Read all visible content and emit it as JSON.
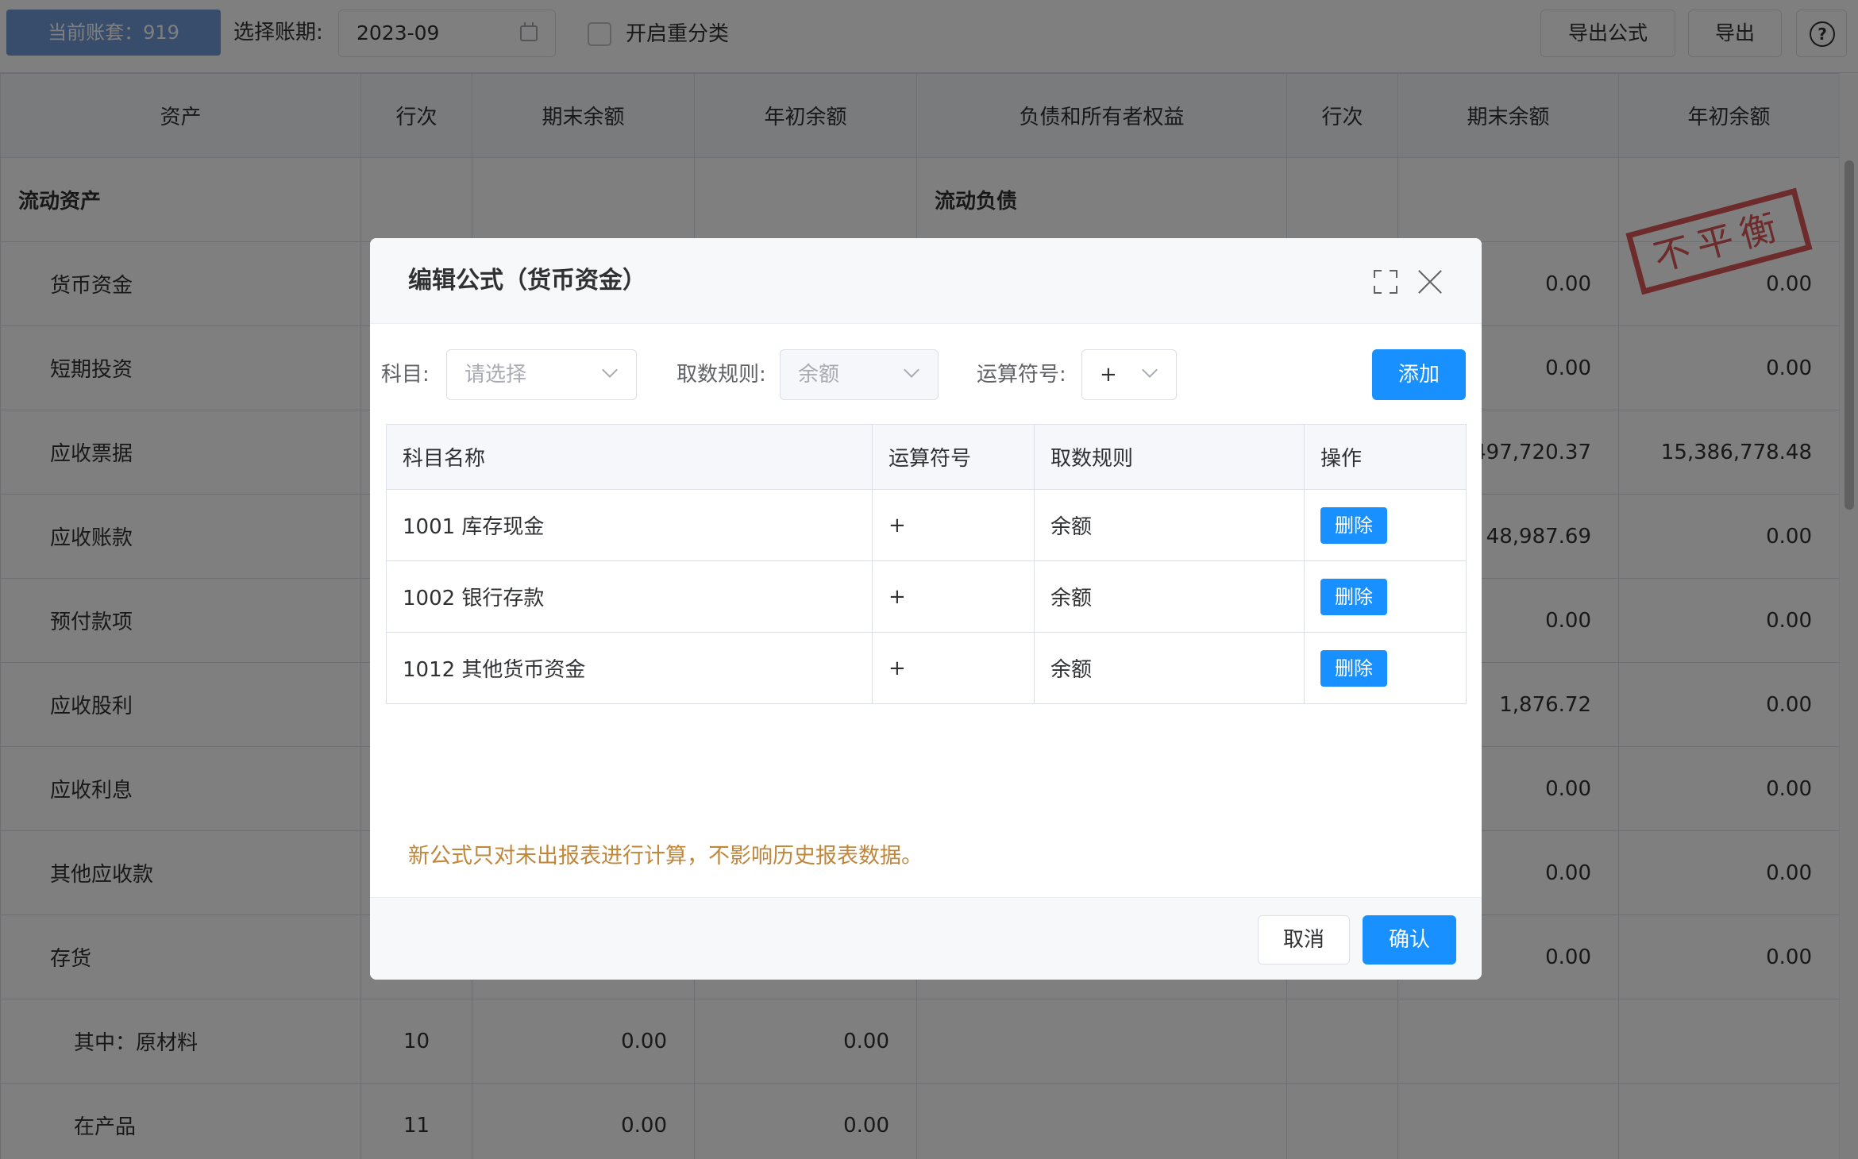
{
  "toolbar": {
    "account_label": "当前账套：919",
    "period_label": "选择账期:",
    "period_value": "2023-09",
    "reclassify_label": "开启重分类",
    "export_formula_label": "导出公式",
    "export_label": "导出",
    "help_icon": "question-circle-icon"
  },
  "report": {
    "columns": [
      "资产",
      "行次",
      "期末余额",
      "年初余额",
      "负债和所有者权益",
      "行次",
      "期末余额",
      "年初余额"
    ],
    "rows": [
      {
        "asset": "流动资产",
        "line": "",
        "end": "",
        "begin": "",
        "liab": "流动负债",
        "lline": "",
        "lend": "",
        "lbegin": ""
      },
      {
        "asset": "货币资金",
        "line": "",
        "end": "",
        "begin": "",
        "liab": "",
        "lline": "",
        "lend": "0.00",
        "lbegin": "0.00"
      },
      {
        "asset": "短期投资",
        "line": "",
        "end": "",
        "begin": "",
        "liab": "",
        "lline": "",
        "lend": "0.00",
        "lbegin": "0.00"
      },
      {
        "asset": "应收票据",
        "line": "",
        "end": "",
        "begin": "",
        "liab": "",
        "lline": "",
        "lend": "497,720.37",
        "lbegin": "15,386,778.48"
      },
      {
        "asset": "应收账款",
        "line": "",
        "end": "",
        "begin": "",
        "liab": "",
        "lline": "",
        "lend": "48,987.69",
        "lbegin": "0.00"
      },
      {
        "asset": "预付款项",
        "line": "",
        "end": "",
        "begin": "",
        "liab": "",
        "lline": "",
        "lend": "0.00",
        "lbegin": "0.00"
      },
      {
        "asset": "应收股利",
        "line": "",
        "end": "",
        "begin": "",
        "liab": "",
        "lline": "",
        "lend": "1,876.72",
        "lbegin": "0.00"
      },
      {
        "asset": "应收利息",
        "line": "",
        "end": "",
        "begin": "",
        "liab": "",
        "lline": "",
        "lend": "0.00",
        "lbegin": "0.00"
      },
      {
        "asset": "其他应收款",
        "line": "",
        "end": "",
        "begin": "",
        "liab": "",
        "lline": "",
        "lend": "0.00",
        "lbegin": "0.00"
      },
      {
        "asset": "存货",
        "line": "",
        "end": "",
        "begin": "",
        "liab": "",
        "lline": "",
        "lend": "0.00",
        "lbegin": "0.00"
      },
      {
        "asset": "其中：原材料",
        "line": "10",
        "end": "0.00",
        "begin": "0.00",
        "liab": "",
        "lline": "",
        "lend": "",
        "lbegin": ""
      },
      {
        "asset": "在产品",
        "line": "11",
        "end": "0.00",
        "begin": "0.00",
        "liab": "",
        "lline": "",
        "lend": "",
        "lbegin": ""
      }
    ],
    "stamp_text": "不平衡",
    "stamp_color": "#d63a3a"
  },
  "dialog": {
    "title": "编辑公式（货币资金）",
    "maximize_icon": "fullscreen-icon",
    "close_icon": "close-icon",
    "subject_label": "科目:",
    "subject_placeholder": "请选择",
    "rule_label": "取数规则:",
    "rule_value": "余额",
    "operator_label": "运算符号:",
    "operator_value": "+",
    "add_label": "添加",
    "table": {
      "headers": [
        "科目名称",
        "运算符号",
        "取数规则",
        "操作"
      ],
      "rows": [
        {
          "name": "1001 库存现金",
          "op": "+",
          "rule": "余额",
          "action": "删除"
        },
        {
          "name": "1002 银行存款",
          "op": "+",
          "rule": "余额",
          "action": "删除"
        },
        {
          "name": "1012 其他货币资金",
          "op": "+",
          "rule": "余额",
          "action": "删除"
        }
      ]
    },
    "note": "新公式只对未出报表进行计算，不影响历史报表数据。",
    "cancel_label": "取消",
    "ok_label": "确认",
    "accent_color": "#1890ff"
  }
}
